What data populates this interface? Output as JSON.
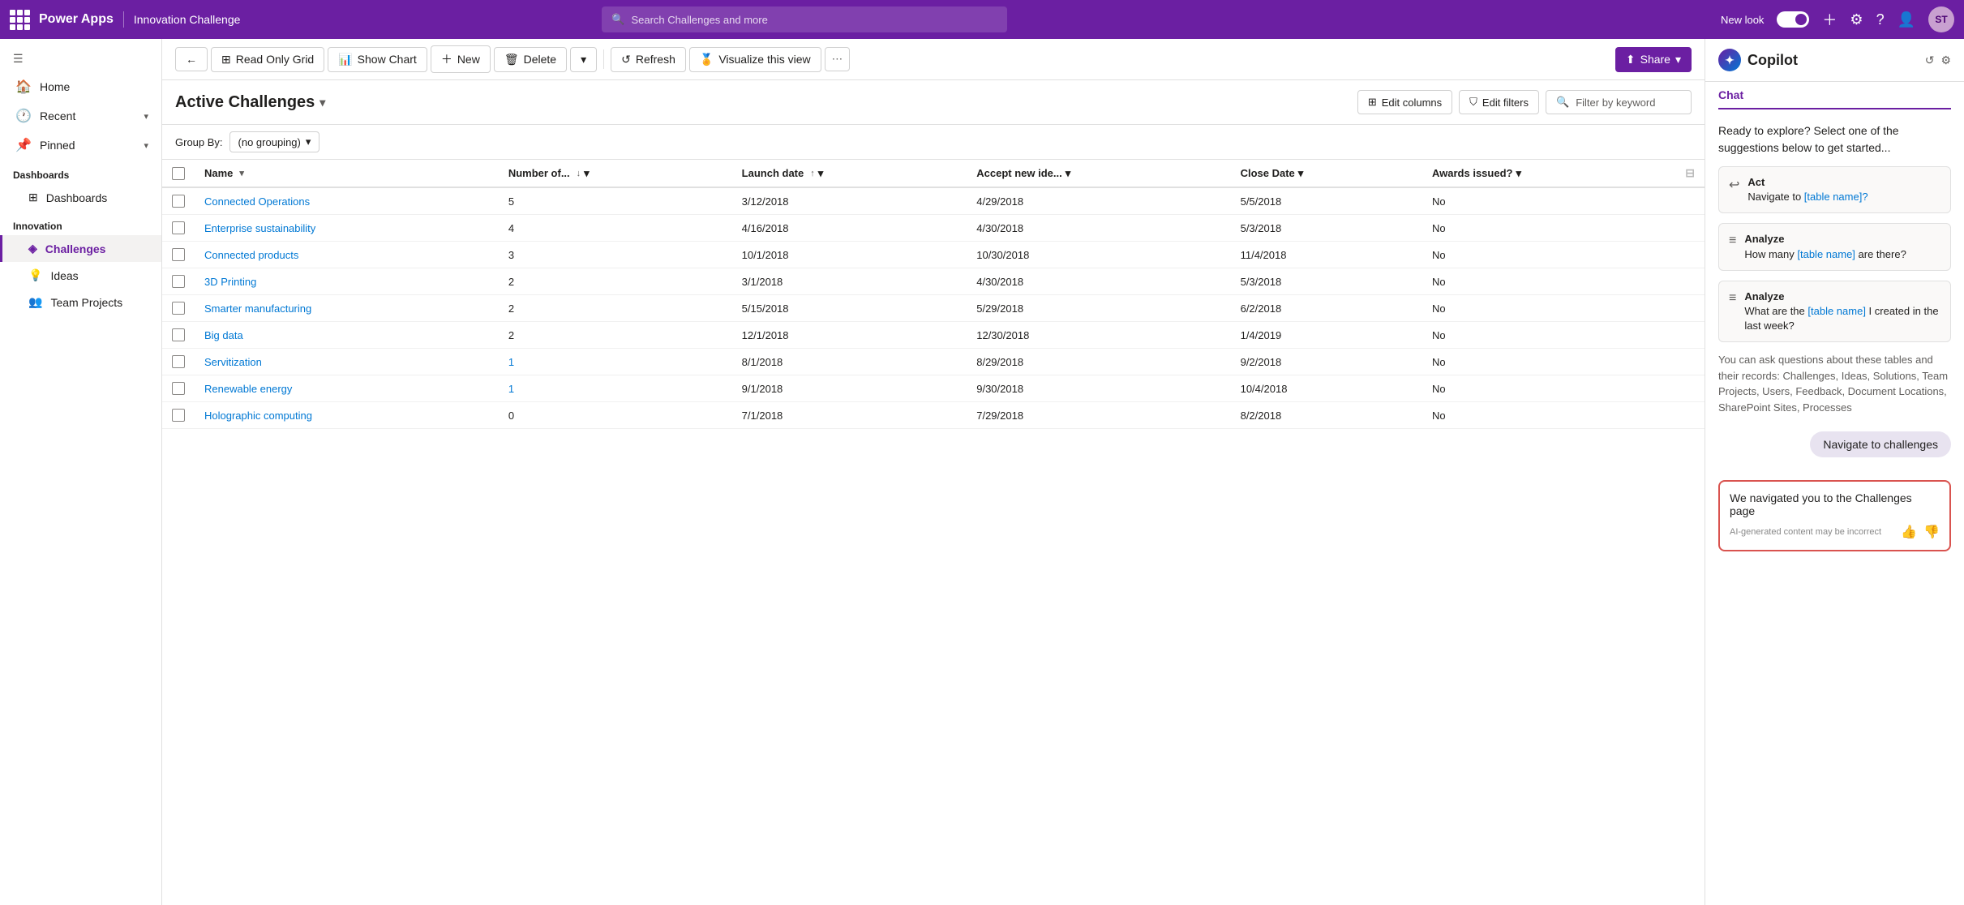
{
  "topNav": {
    "appName": "Power Apps",
    "appTitle": "Innovation Challenge",
    "searchPlaceholder": "Search Challenges and more",
    "newLookLabel": "New look",
    "avatarInitials": "ST"
  },
  "sidebar": {
    "toggleLabel": "☰",
    "homeLabel": "Home",
    "recentLabel": "Recent",
    "pinnedLabel": "Pinned",
    "dashboardsSection": "Dashboards",
    "dashboardsItem": "Dashboards",
    "innovationSection": "Innovation",
    "challengesItem": "Challenges",
    "ideasItem": "Ideas",
    "teamProjectsItem": "Team Projects"
  },
  "toolbar": {
    "backLabel": "←",
    "readOnlyGridLabel": "Read Only Grid",
    "showChartLabel": "Show Chart",
    "newLabel": "New",
    "deleteLabel": "Delete",
    "refreshLabel": "Refresh",
    "visualizeLabel": "Visualize this view",
    "shareLabel": "Share",
    "moreLabel": "⋯"
  },
  "viewHeader": {
    "title": "Active Challenges",
    "editColumnsLabel": "Edit columns",
    "editFiltersLabel": "Edit filters",
    "filterPlaceholder": "Filter by keyword",
    "groupByLabel": "Group By:",
    "groupByValue": "(no grouping)"
  },
  "columns": [
    {
      "label": "Name",
      "sort": "asc"
    },
    {
      "label": "Number of...",
      "sort": "desc"
    },
    {
      "label": "Launch date",
      "sort": "asc"
    },
    {
      "label": "Accept new ide...",
      "sort": "none"
    },
    {
      "label": "Close Date",
      "sort": "none"
    },
    {
      "label": "Awards issued?",
      "sort": "none"
    }
  ],
  "rows": [
    {
      "name": "Connected Operations",
      "number": "5",
      "isLink": false,
      "launchDate": "3/12/2018",
      "acceptDate": "4/29/2018",
      "closeDate": "5/5/2018",
      "awards": "No"
    },
    {
      "name": "Enterprise sustainability",
      "number": "4",
      "isLink": false,
      "launchDate": "4/16/2018",
      "acceptDate": "4/30/2018",
      "closeDate": "5/3/2018",
      "awards": "No"
    },
    {
      "name": "Connected products",
      "number": "3",
      "isLink": false,
      "launchDate": "10/1/2018",
      "acceptDate": "10/30/2018",
      "closeDate": "11/4/2018",
      "awards": "No"
    },
    {
      "name": "3D Printing",
      "number": "2",
      "isLink": false,
      "launchDate": "3/1/2018",
      "acceptDate": "4/30/2018",
      "closeDate": "5/3/2018",
      "awards": "No"
    },
    {
      "name": "Smarter manufacturing",
      "number": "2",
      "isLink": false,
      "launchDate": "5/15/2018",
      "acceptDate": "5/29/2018",
      "closeDate": "6/2/2018",
      "awards": "No"
    },
    {
      "name": "Big data",
      "number": "2",
      "isLink": false,
      "launchDate": "12/1/2018",
      "acceptDate": "12/30/2018",
      "closeDate": "1/4/2019",
      "awards": "No"
    },
    {
      "name": "Servitization",
      "number": "1",
      "isLink": true,
      "launchDate": "8/1/2018",
      "acceptDate": "8/29/2018",
      "closeDate": "9/2/2018",
      "awards": "No"
    },
    {
      "name": "Renewable energy",
      "number": "1",
      "isLink": true,
      "launchDate": "9/1/2018",
      "acceptDate": "9/30/2018",
      "closeDate": "10/4/2018",
      "awards": "No"
    },
    {
      "name": "Holographic computing",
      "number": "0",
      "isLink": false,
      "launchDate": "7/1/2018",
      "acceptDate": "7/29/2018",
      "closeDate": "8/2/2018",
      "awards": "No"
    }
  ],
  "copilot": {
    "title": "Copilot",
    "tabLabel": "Chat",
    "introText": "Ready to explore? Select one of the suggestions below to get started...",
    "suggestions": [
      {
        "icon": "↩",
        "type": "Act",
        "text": "Navigate to [table name]?"
      },
      {
        "icon": "≡",
        "type": "Analyze",
        "text": "How many [table name] are there?"
      },
      {
        "icon": "≡",
        "type": "Analyze",
        "text": "What are the [table name] I created in the last week?"
      }
    ],
    "infoText": "You can ask questions about these tables and their records: Challenges, Ideas, Solutions, Team Projects, Users, Feedback, Document Locations, SharePoint Sites, Processes",
    "navigateBubble": "Navigate to challenges",
    "responseText": "We navigated you to the Challenges page",
    "disclaimer": "AI-generated content may be incorrect",
    "thumbUpLabel": "👍",
    "thumbDownLabel": "👎"
  }
}
